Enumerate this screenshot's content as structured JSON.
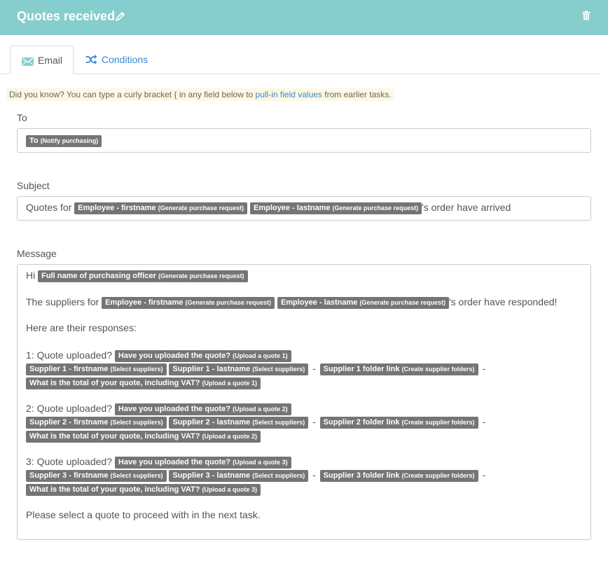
{
  "header": {
    "title": "Quotes received"
  },
  "tabs": [
    {
      "label": "Email"
    },
    {
      "label": "Conditions"
    }
  ],
  "tip": {
    "prefix": "Did you know? You can type a curly bracket { in any field below to ",
    "link": "pull-in field values",
    "suffix": " from earlier tasks."
  },
  "to": {
    "label": "To",
    "tag": {
      "name": "To",
      "source": "(Notify purchasing)"
    }
  },
  "subject": {
    "label": "Subject",
    "prefix": "Quotes for ",
    "tags": [
      {
        "name": "Employee - firstname",
        "source": "(Generate purchase request)"
      },
      {
        "name": "Employee - lastname",
        "source": "(Generate purchase request)"
      }
    ],
    "suffix": "'s order have arrived"
  },
  "message": {
    "label": "Message",
    "greeting": "Hi",
    "greeting_tag": {
      "name": "Full name of purchasing officer",
      "source": "(Generate purchase request)"
    },
    "suppliers_prefix": "The suppliers for",
    "suppliers_tags": [
      {
        "name": "Employee - firstname",
        "source": "(Generate purchase request)"
      },
      {
        "name": "Employee - lastname",
        "source": "(Generate purchase request)"
      }
    ],
    "suppliers_suffix": "'s order have responded!",
    "responses_intro": "Here are their responses:",
    "separator": "-",
    "quotes": [
      {
        "prefix": "1: Quote uploaded?",
        "uploaded": {
          "name": "Have you uploaded the quote?",
          "source": "(Upload a quote 1)"
        },
        "firstname": {
          "name": "Supplier 1 - firstname",
          "source": "(Select suppliers)"
        },
        "lastname": {
          "name": "Supplier 1 - lastname",
          "source": "(Select suppliers)"
        },
        "folder": {
          "name": "Supplier 1 folder link",
          "source": "(Create supplier folders)"
        },
        "total": {
          "name": "What is the total of your quote, including VAT?",
          "source": "(Upload a quote 1)"
        }
      },
      {
        "prefix": "2: Quote uploaded?",
        "uploaded": {
          "name": "Have you uploaded the quote?",
          "source": "(Upload a quote 2)"
        },
        "firstname": {
          "name": "Supplier 2 - firstname",
          "source": "(Select suppliers)"
        },
        "lastname": {
          "name": "Supplier 2 - lastname",
          "source": "(Select suppliers)"
        },
        "folder": {
          "name": "Supplier 2 folder link",
          "source": "(Create supplier folders)"
        },
        "total": {
          "name": "What is the total of your quote, including VAT?",
          "source": "(Upload a quote 2)"
        }
      },
      {
        "prefix": "3: Quote uploaded?",
        "uploaded": {
          "name": "Have you uploaded the quote?",
          "source": "(Upload a quote 3)"
        },
        "firstname": {
          "name": "Supplier 3 - firstname",
          "source": "(Select suppliers)"
        },
        "lastname": {
          "name": "Supplier 3 - lastname",
          "source": "(Select suppliers)"
        },
        "folder": {
          "name": "Supplier 3 folder link",
          "source": "(Create supplier folders)"
        },
        "total": {
          "name": "What is the total of your quote, including VAT?",
          "source": "(Upload a quote 3)"
        }
      }
    ],
    "closing": "Please select a quote to proceed with in the next task."
  },
  "colors": {
    "header_bg": "#86cecd",
    "tag_bg": "#757575",
    "link": "#3a87d6",
    "tip_bg": "#fcf8e3"
  },
  "icons": {
    "edit": "pencil-icon",
    "delete": "trash-icon",
    "email_tab": "envelope-icon",
    "conditions_tab": "shuffle-icon"
  }
}
